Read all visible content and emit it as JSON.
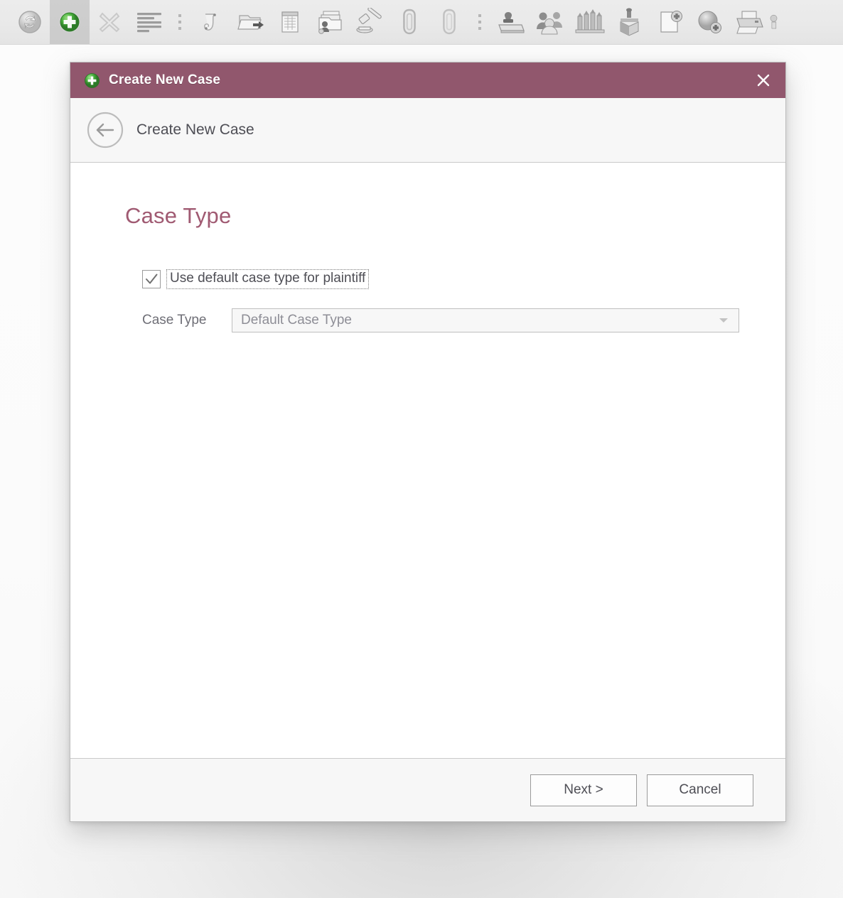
{
  "toolbar": {
    "items": [
      {
        "name": "refresh-icon",
        "type": "icon",
        "active": false
      },
      {
        "name": "add-new-case-icon",
        "type": "icon",
        "active": true
      },
      {
        "name": "delete-x-icon",
        "type": "icon",
        "active": false
      },
      {
        "name": "list-lines-icon",
        "type": "icon",
        "active": false
      },
      {
        "name": "toolbar-separator",
        "type": "separator",
        "active": false
      },
      {
        "name": "scroll-document-icon",
        "type": "icon",
        "active": false
      },
      {
        "name": "export-folder-icon",
        "type": "icon",
        "active": false
      },
      {
        "name": "ledger-page-icon",
        "type": "icon",
        "active": false
      },
      {
        "name": "client-folder-icon",
        "type": "icon",
        "active": false
      },
      {
        "name": "gavel-icon",
        "type": "icon",
        "active": false
      },
      {
        "name": "paperclip-icon",
        "type": "icon",
        "active": false
      },
      {
        "name": "paperclip-alt-icon",
        "type": "icon",
        "active": false
      },
      {
        "name": "toolbar-separator",
        "type": "separator",
        "active": false
      },
      {
        "name": "rubber-stamp-icon",
        "type": "icon",
        "active": false
      },
      {
        "name": "people-group-icon",
        "type": "icon",
        "active": false
      },
      {
        "name": "courthouse-icon",
        "type": "icon",
        "active": false
      },
      {
        "name": "box-archive-icon",
        "type": "icon",
        "active": false
      },
      {
        "name": "new-document-icon",
        "type": "icon",
        "active": false
      },
      {
        "name": "add-disc-icon",
        "type": "icon",
        "active": false
      },
      {
        "name": "printer-icon",
        "type": "icon",
        "active": false
      },
      {
        "name": "partial-edge-icon",
        "type": "icon",
        "active": false
      }
    ]
  },
  "dialog": {
    "title": "Create New Case",
    "title_icon": "green-plus-circle-icon",
    "close_label": "✕",
    "navbar": {
      "back_icon": "back-arrow-circle-icon",
      "title": "Create New Case"
    },
    "body": {
      "heading": "Case Type",
      "checkbox": {
        "label": "Use default case type for plaintiff",
        "checked": true,
        "focused": true
      },
      "case_type_field": {
        "label": "Case Type",
        "value": "Default Case Type",
        "enabled": false,
        "options": [
          "Default Case Type"
        ]
      }
    },
    "footer": {
      "next_label": "Next >",
      "cancel_label": "Cancel"
    }
  },
  "colors": {
    "titlebar": "#91576d",
    "heading": "#a05a72",
    "toolbar_bg": "#eaeaea",
    "panel_bg": "#f7f7f7",
    "text": "#4e4e55",
    "muted_text": "#8e8e96",
    "accent_green": "#3fa13f"
  }
}
